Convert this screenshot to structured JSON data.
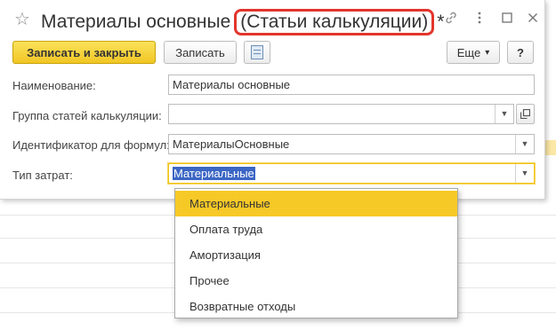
{
  "window": {
    "title_main": "Материалы основные",
    "title_sub": "(Статьи калькуляции)",
    "title_modified": "*",
    "icons": [
      "star-icon",
      "link-icon",
      "more-vertical-icon",
      "maximize-icon",
      "close-icon"
    ]
  },
  "toolbar": {
    "save_close_label": "Записать и закрыть",
    "save_label": "Записать",
    "more_label": "Еще",
    "more_arrow": "▾",
    "help_label": "?"
  },
  "form": {
    "name_label": "Наименование:",
    "name_value": "Материалы основные",
    "group_label": "Группа статей калькуляции:",
    "group_value": "",
    "formula_id_label": "Идентификатор для формул:",
    "formula_id_value": "МатериалыОсновные",
    "cost_type_label": "Тип затрат:",
    "cost_type_value": "Материальные"
  },
  "dropdown": {
    "items": [
      "Материальные",
      "Оплата труда",
      "Амортизация",
      "Прочее",
      "Возвратные отходы"
    ],
    "selected": "Материальные"
  },
  "colors": {
    "primary_button": "#f1c625",
    "highlight_item": "#f7c927",
    "title_annotation": "#e2352c",
    "selection": "#3b66c4"
  }
}
